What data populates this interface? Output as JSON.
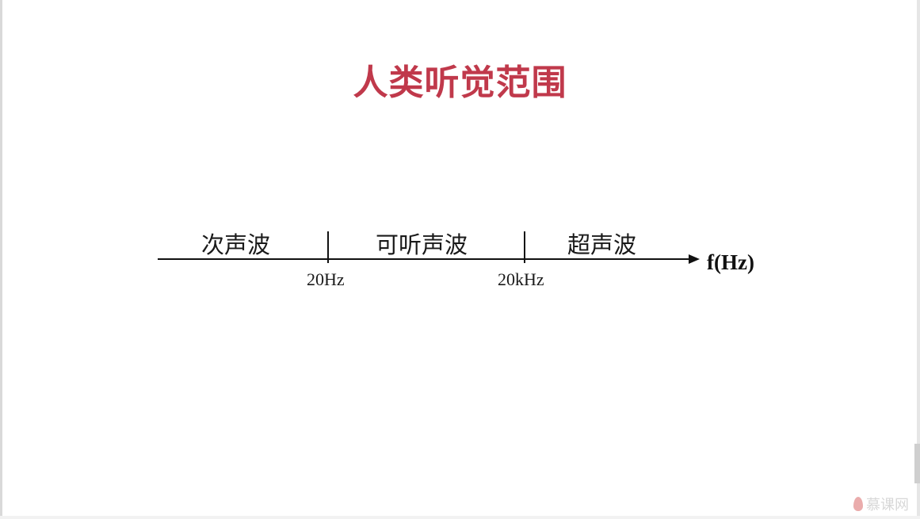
{
  "title": "人类听觉范围",
  "axis": {
    "unit_label": "f(Hz)",
    "regions": [
      "次声波",
      "可听声波",
      "超声波"
    ],
    "boundaries": [
      "20Hz",
      "20kHz"
    ]
  },
  "colors": {
    "title": "#c0394b",
    "line": "#111111",
    "text": "#1a1a1a"
  },
  "watermark": {
    "text": "慕课网",
    "icon": "flame-icon"
  }
}
